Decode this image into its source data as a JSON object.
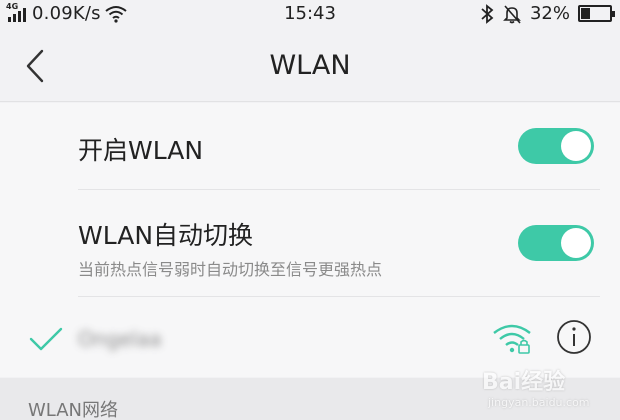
{
  "status_bar": {
    "network_type": "4G",
    "speed": "0.09K/s",
    "time": "15:43",
    "battery": "32%",
    "battery_level": 0.32,
    "icons": [
      "signal-icon",
      "wifi-icon",
      "bluetooth-icon",
      "mute-bell-icon",
      "battery-icon"
    ]
  },
  "nav": {
    "title": "WLAN",
    "back_icon": "chevron-left-icon"
  },
  "settings": {
    "wlan_toggle": {
      "label": "开启WLAN",
      "on": true
    },
    "auto_switch": {
      "label": "WLAN自动切换",
      "subtitle": "当前热点信号弱时自动切换至信号更强热点",
      "on": true
    }
  },
  "connected_network": {
    "ssid": "Ongelaa",
    "status_icon": "checkmark-icon",
    "signal_icon": "wifi-locked-icon",
    "info_icon": "info-icon"
  },
  "section": {
    "title": "WLAN网络"
  },
  "watermark": {
    "text": "Bai经验",
    "sub": "jingyan.baidu.com"
  },
  "colors": {
    "accent": "#3ec9a7",
    "background": "#f2f2f4",
    "card": "#f7f7f8",
    "section": "#e9e9eb"
  }
}
